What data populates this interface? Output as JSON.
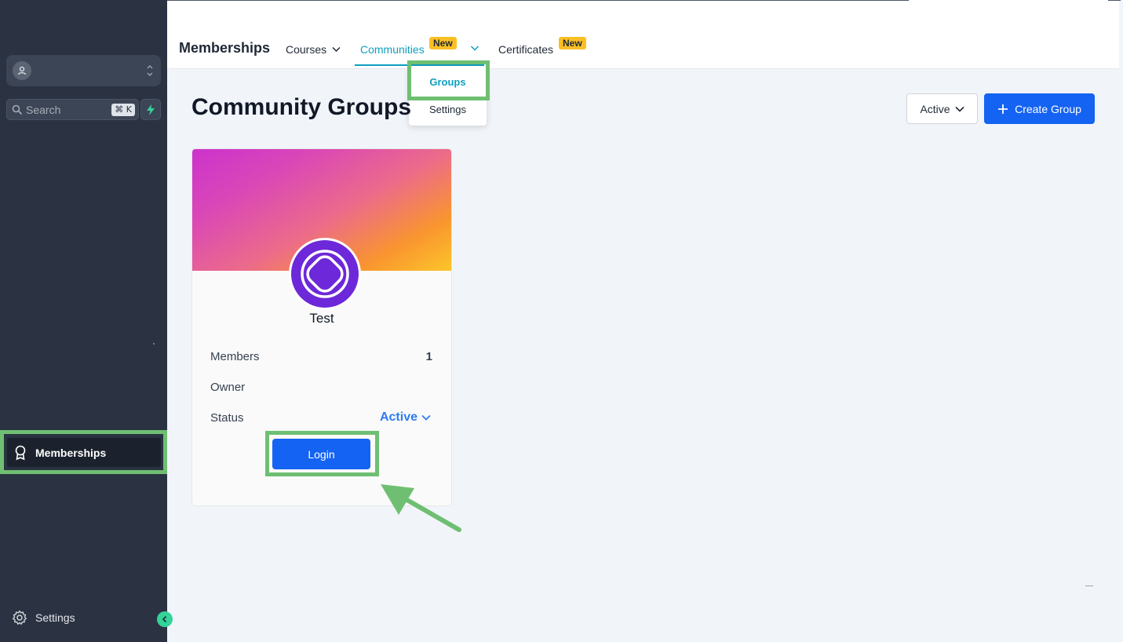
{
  "sidebar": {
    "search": {
      "placeholder": "Search",
      "shortcut": "⌘ K"
    },
    "nav": {
      "memberships": "Memberships",
      "settings": "Settings"
    }
  },
  "topnav": {
    "title": "Memberships",
    "tabs": {
      "courses": "Courses",
      "communities": "Communities",
      "certificates": "Certificates"
    },
    "new_badge": "New",
    "communities_menu": {
      "groups": "Groups",
      "settings": "Settings"
    }
  },
  "page": {
    "title": "Community Groups",
    "filter_value": "Active",
    "create_label": "Create Group"
  },
  "group_card": {
    "name": "Test",
    "members_label": "Members",
    "members_value": "1",
    "owner_label": "Owner",
    "status_label": "Status",
    "status_value": "Active",
    "login_label": "Login"
  },
  "colors": {
    "sidebar_bg": "#2b3342",
    "accent_blue": "#1463f3",
    "tab_active": "#0e9fbf",
    "highlight_green": "#6fbf73",
    "badge_yellow": "#fbbf24",
    "avatar_purple": "#6d28d9"
  },
  "icons": {
    "account": "user-circle-icon",
    "search": "search-icon",
    "bolt": "bolt-icon",
    "memberships": "ribbon-award-icon",
    "settings": "gear-icon",
    "collapse": "chevron-left-icon",
    "dropdown": "chevron-down-icon",
    "create": "plus-icon",
    "group_avatar": "circle-knot-logo-icon"
  }
}
